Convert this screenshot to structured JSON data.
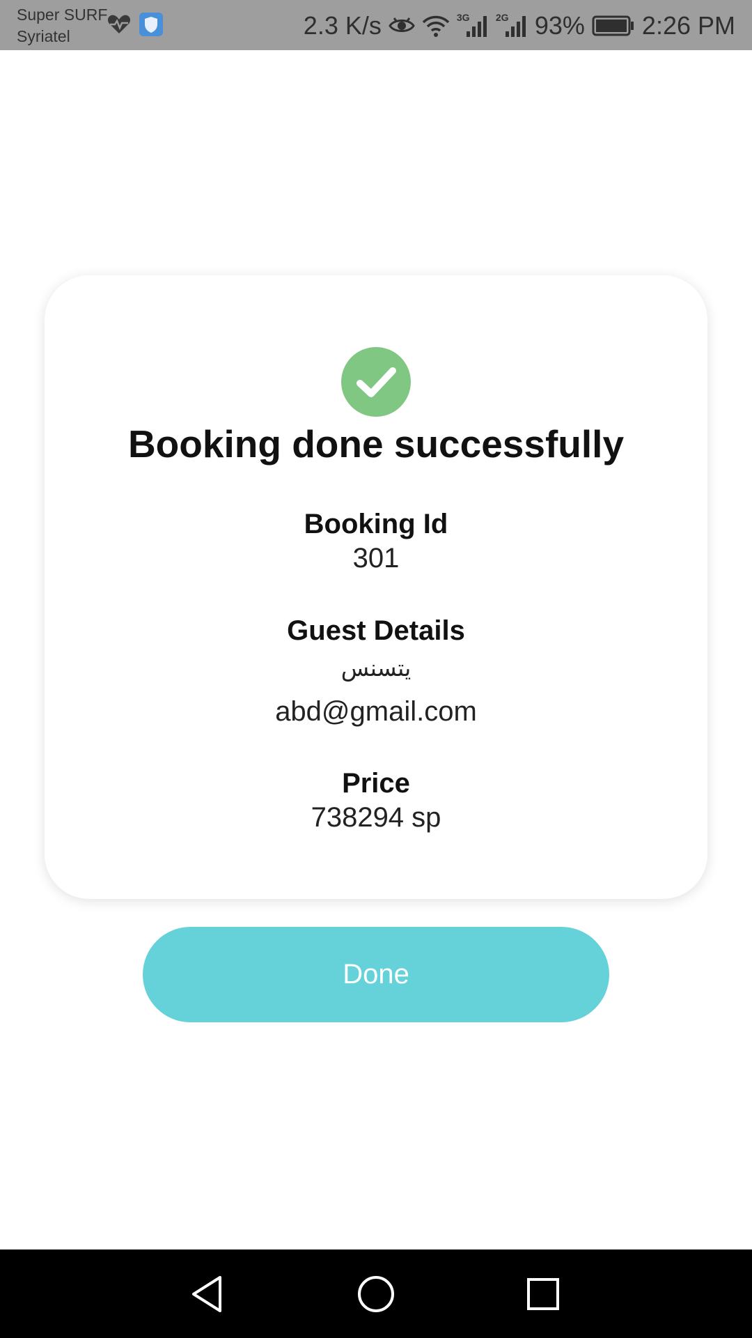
{
  "status_bar": {
    "carrier_line1": "Super SURF",
    "carrier_line2": "Syriatel",
    "net_speed": "2.3 K/s",
    "network_3g": "3G",
    "network_2g": "2G",
    "battery_percent": "93%",
    "time": "2:26 PM",
    "icons": [
      "heart-pulse-icon",
      "shield-icon",
      "eye-icon",
      "wifi-icon",
      "signal-icon",
      "battery-icon"
    ]
  },
  "booking": {
    "title": "Booking done successfully",
    "id_label": "Booking Id",
    "id_value": "301",
    "guest_label": "Guest Details",
    "guest_name": "يتسنس",
    "guest_email": "abd@gmail.com",
    "price_label": "Price",
    "price_value": "738294 sp"
  },
  "actions": {
    "done_label": "Done"
  },
  "colors": {
    "status_bar": "#9e9e9e",
    "success_green": "#81c784",
    "accent_teal": "#64d2d8",
    "nav_bar": "#000000"
  },
  "nav_bar": {
    "icons": [
      "back-icon",
      "home-icon",
      "recents-icon"
    ]
  }
}
